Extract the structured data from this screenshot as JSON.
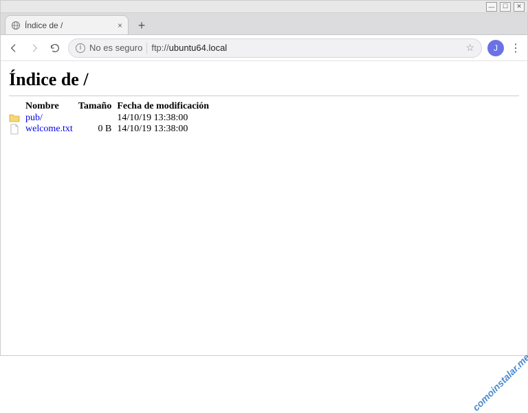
{
  "window": {
    "minimize": "—",
    "maximize": "☐",
    "close": "✕"
  },
  "tab": {
    "title": "Índice de /"
  },
  "toolbar": {
    "security_label": "No es seguro",
    "url_prefix": "ftp://",
    "url_host": "ubuntu64.local",
    "avatar_initial": "J"
  },
  "page": {
    "heading": "Índice de /",
    "columns": {
      "name": "Nombre",
      "size": "Tamaño",
      "modified": "Fecha de modificación"
    },
    "entries": [
      {
        "icon": "folder",
        "name": "pub/",
        "size": "",
        "modified": "14/10/19 13:38:00"
      },
      {
        "icon": "file",
        "name": "welcome.txt",
        "size": "0 B",
        "modified": "14/10/19 13:38:00"
      }
    ]
  },
  "watermark": "comoinstalar.me"
}
